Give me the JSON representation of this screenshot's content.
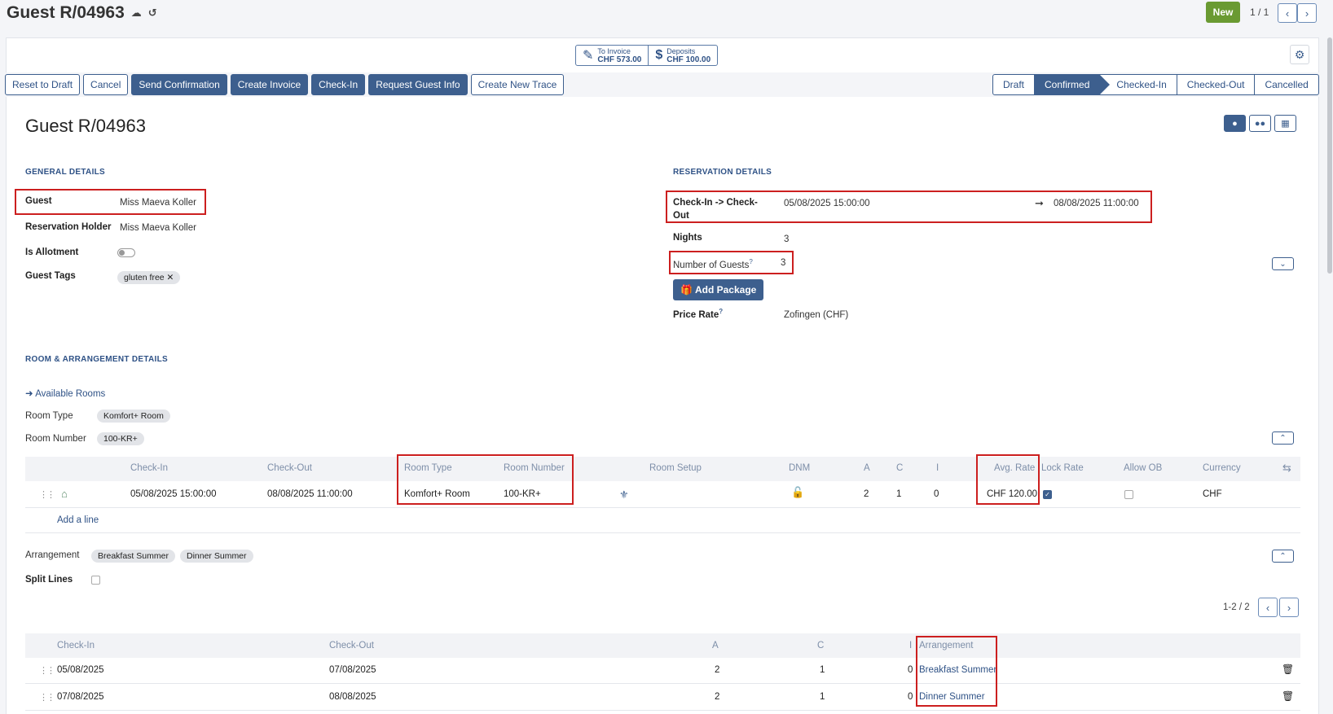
{
  "top": {
    "title": "Guest R/04963",
    "new_label": "New",
    "pager": "1 / 1"
  },
  "smart_buttons": [
    {
      "line1": "To Invoice",
      "line2": "CHF 573.00",
      "icon": "edit-icon"
    },
    {
      "line1": "Deposits",
      "line2": "CHF 100.00",
      "icon": "dollar-icon"
    }
  ],
  "actions": [
    "Reset to Draft",
    "Cancel",
    "Send Confirmation",
    "Create Invoice",
    "Check-In",
    "Request Guest Info",
    "Create New Trace"
  ],
  "statuses": [
    "Draft",
    "Confirmed",
    "Checked-In",
    "Checked-Out",
    "Cancelled"
  ],
  "record_title": "Guest R/04963",
  "general": {
    "header": "GENERAL DETAILS",
    "guest_label": "Guest",
    "guest_value": "Miss Maeva Koller",
    "holder_label": "Reservation Holder",
    "holder_value": "Miss Maeva Koller",
    "allotment_label": "Is Allotment",
    "tags_label": "Guest Tags",
    "tag": "gluten free"
  },
  "reservation": {
    "header": "RESERVATION DETAILS",
    "checkin_label_1": "Check-In -> Check-",
    "checkin_label_2": "Out",
    "checkin_value": "05/08/2025 15:00:00",
    "checkout_value": "08/08/2025 11:00:00",
    "nights_label": "Nights",
    "nights_value": "3",
    "guests_label": "Number of Guests",
    "guests_value": "3",
    "package_button": "Add Package",
    "price_rate_label": "Price Rate",
    "price_rate_value": "Zofingen (CHF)",
    "help_mark": "?"
  },
  "room": {
    "header": "ROOM & ARRANGEMENT DETAILS",
    "available_link": "Available Rooms",
    "type_label": "Room Type",
    "type_value": "Komfort+ Room",
    "number_label": "Room Number",
    "number_value": "100-KR+",
    "columns": [
      "Check-In",
      "Check-Out",
      "Room Type",
      "Room Number",
      "Room Setup",
      "DNM",
      "A",
      "C",
      "I",
      "Avg. Rate",
      "Lock Rate",
      "Allow OB",
      "Currency"
    ],
    "row": {
      "checkin": "05/08/2025 15:00:00",
      "checkout": "08/08/2025 11:00:00",
      "type": "Komfort+ Room",
      "number": "100-KR+",
      "a": "2",
      "c": "1",
      "i": "0",
      "avg_rate": "CHF 120.00",
      "currency": "CHF"
    },
    "add_line": "Add a line"
  },
  "arrangement": {
    "label": "Arrangement",
    "tags": [
      "Breakfast Summer",
      "Dinner Summer"
    ],
    "split_label": "Split Lines",
    "pager": "1-2 / 2",
    "columns": [
      "Check-In",
      "Check-Out",
      "A",
      "C",
      "I",
      "Arrangement"
    ],
    "rows": [
      {
        "checkin": "05/08/2025",
        "checkout": "07/08/2025",
        "a": "2",
        "c": "1",
        "i": "0",
        "arrangement": "Breakfast Summer"
      },
      {
        "checkin": "07/08/2025",
        "checkout": "08/08/2025",
        "a": "2",
        "c": "1",
        "i": "0",
        "arrangement": "Dinner Summer"
      }
    ]
  }
}
